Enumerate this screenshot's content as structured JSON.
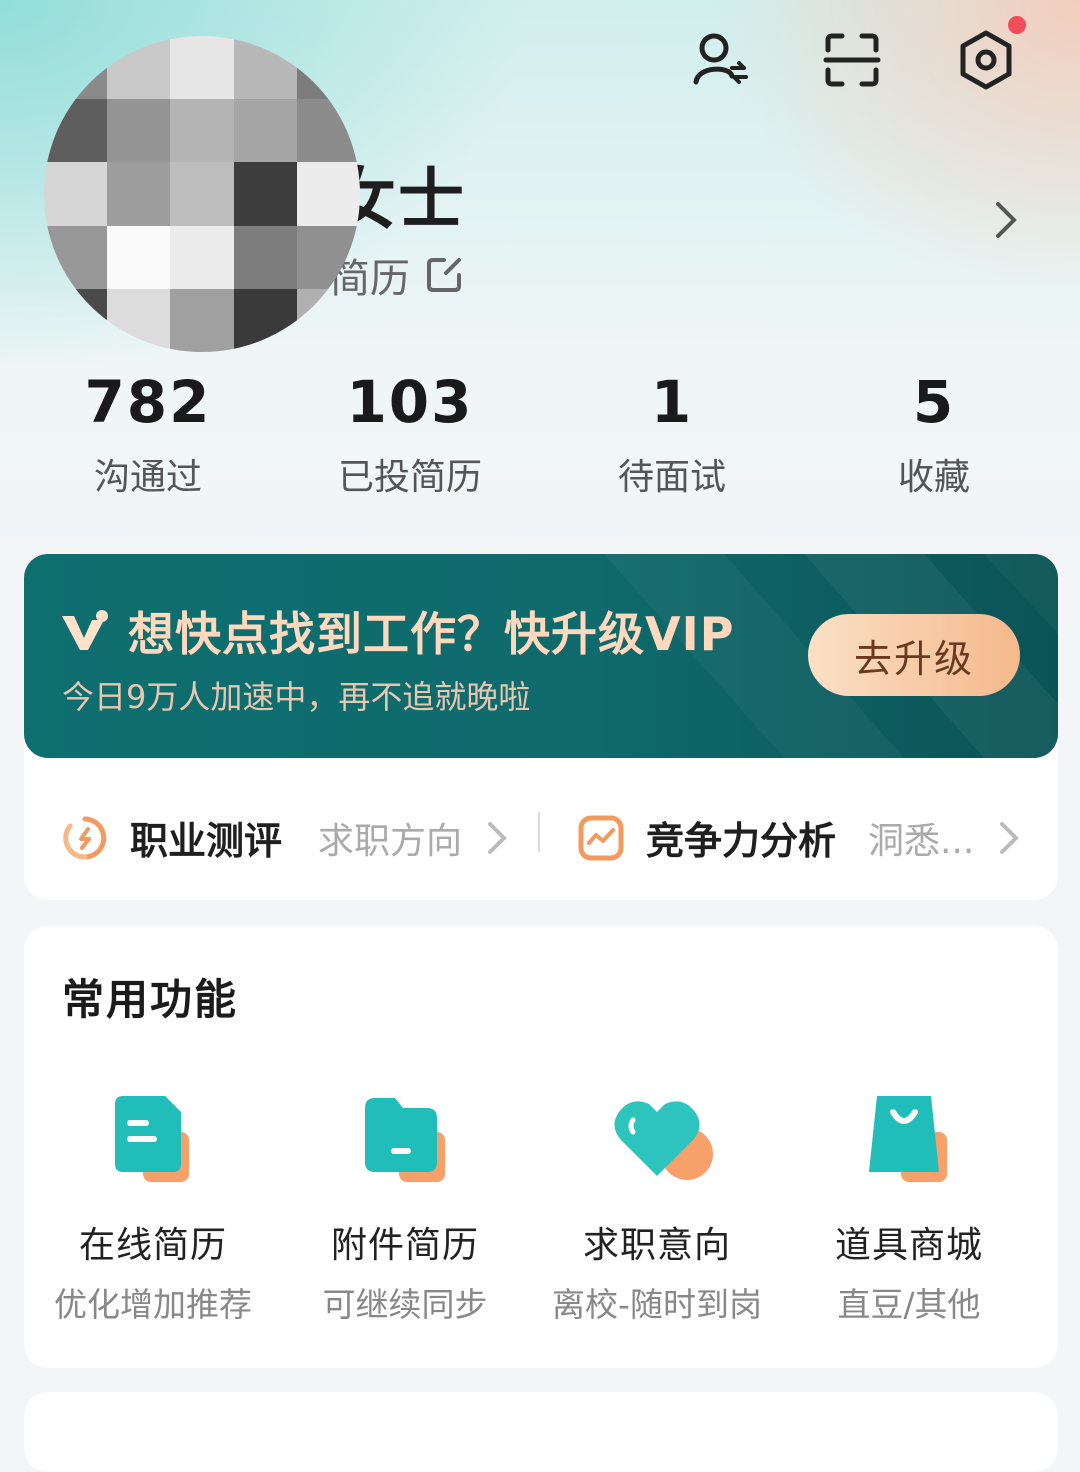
{
  "profile": {
    "name": "女士",
    "resume_link": "简历",
    "stats": [
      {
        "value": "782",
        "label": "沟通过"
      },
      {
        "value": "103",
        "label": "已投简历"
      },
      {
        "value": "1",
        "label": "待面试"
      },
      {
        "value": "5",
        "label": "收藏"
      }
    ]
  },
  "vip": {
    "title": "想快点找到工作？快升级VIP",
    "subtitle": "今日9万人加速中，再不追就晚啦",
    "button": "去升级"
  },
  "quick": {
    "assessment_title": "职业测评",
    "assessment_sub": "求职方向",
    "analysis_title": "竞争力分析",
    "analysis_sub": "洞悉..."
  },
  "functions": {
    "title": "常用功能",
    "items": [
      {
        "name": "在线简历",
        "desc": "优化增加推荐",
        "icon": "online-resume-icon"
      },
      {
        "name": "附件简历",
        "desc": "可继续同步",
        "icon": "attachment-folder-icon"
      },
      {
        "name": "求职意向",
        "desc": "离校-随时到岗",
        "icon": "heart-icon"
      },
      {
        "name": "道具商城",
        "desc": "直豆/其他",
        "icon": "shopping-bag-icon"
      }
    ]
  },
  "colors": {
    "accent": "#1fb8b4",
    "orange": "#f7a06a",
    "vip_bg": "#0e6f6f",
    "notification": "#f24b5a"
  }
}
